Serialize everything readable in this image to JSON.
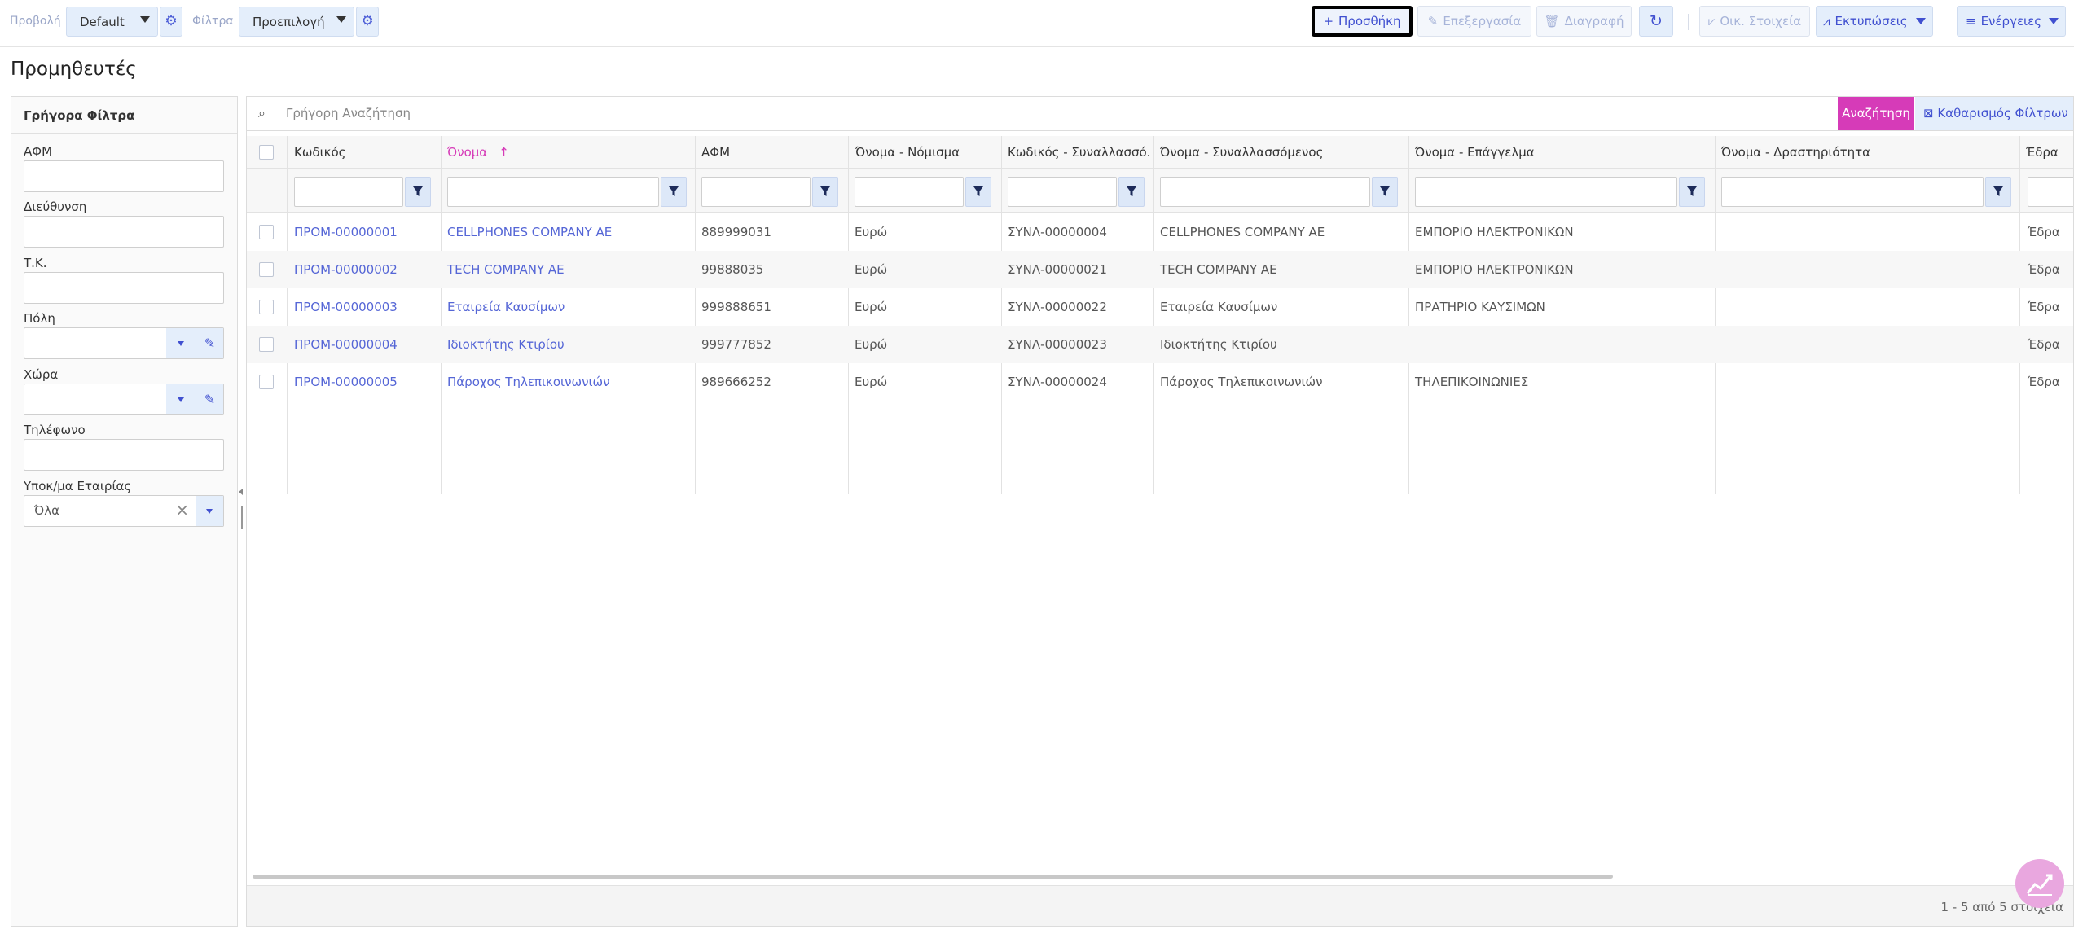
{
  "toolbar": {
    "view_label": "Προβολή",
    "view_value": "Default",
    "filters_label": "Φίλτρα",
    "filters_value": "Προεπιλογή",
    "add": "Προσθήκη",
    "edit": "Επεξεργασία",
    "delete": "Διαγραφή",
    "fin_data": "Οικ. Στοιχεία",
    "prints": "Εκτυπώσεις",
    "actions": "Ενέργειες"
  },
  "page": {
    "title": "Προμηθευτές"
  },
  "quick_filters": {
    "title": "Γρήγορα Φίλτρα",
    "fields": [
      "ΑΦΜ",
      "Διεύθυνση",
      "Τ.Κ.",
      "Πόλη",
      "Χώρα",
      "Τηλέφωνο",
      "Υποκ/μα Εταιρίας"
    ],
    "branch_value": "Όλα"
  },
  "search": {
    "placeholder": "Γρήγορη Αναζήτηση",
    "search_button": "Αναζήτηση",
    "clear_button": "Καθαρισμός Φίλτρων"
  },
  "grid": {
    "columns": [
      "Κωδικός",
      "Όνομα",
      "ΑΦΜ",
      "Όνομα - Νόμισμα",
      "Κωδικός - Συναλλασσό...",
      "Όνομα - Συναλλασσόμενος",
      "Όνομα - Επάγγελμα",
      "Όνομα - Δραστηριότητα",
      "Έδρα"
    ],
    "rows": [
      [
        "ΠΡΟΜ-00000001",
        "CELLPHONES COMPANY AE",
        "889999031",
        "Ευρώ",
        "ΣΥΝΛ-00000004",
        "CELLPHONES COMPANY AE",
        "ΕΜΠΟΡΙΟ ΗΛΕΚΤΡΟΝΙΚΩΝ",
        "",
        "Έδρα"
      ],
      [
        "ΠΡΟΜ-00000002",
        "TECH COMPANY AE",
        "99888035",
        "Ευρώ",
        "ΣΥΝΛ-00000021",
        "TECH COMPANY AE",
        "ΕΜΠΟΡΙΟ ΗΛΕΚΤΡΟΝΙΚΩΝ",
        "",
        "Έδρα"
      ],
      [
        "ΠΡΟΜ-00000003",
        "Εταιρεία Καυσίμων",
        "999888651",
        "Ευρώ",
        "ΣΥΝΛ-00000022",
        "Εταιρεία Καυσίμων",
        "ΠΡΑΤΗΡΙΟ ΚΑΥΣΙΜΩΝ",
        "",
        "Έδρα"
      ],
      [
        "ΠΡΟΜ-00000004",
        "Ιδιοκτήτης Κτιρίου",
        "999777852",
        "Ευρώ",
        "ΣΥΝΛ-00000023",
        "Ιδιοκτήτης Κτιρίου",
        "",
        "",
        "Έδρα"
      ],
      [
        "ΠΡΟΜ-00000005",
        "Πάροχος Τηλεπικοινωνιών",
        "989666252",
        "Ευρώ",
        "ΣΥΝΛ-00000024",
        "Πάροχος Τηλεπικοινωνιών",
        "ΤΗΛΕΠΙΚΟΙΝΩΝΙΕΣ",
        "",
        "Έδρα"
      ]
    ],
    "sorted_column": "Όνομα",
    "footer_info": "1 - 5 από 5 στοιχεία"
  },
  "colors": {
    "accent_pink": "#d63bb8",
    "accent_blue": "#4050d0",
    "link": "#5566d6"
  },
  "icons": {
    "view_settings": "gear-icon",
    "filters_settings": "gear-icon",
    "add": "plus-icon",
    "edit": "pencil-icon",
    "delete": "trash-icon",
    "refresh": "refresh-icon",
    "fin_data": "chart-icon",
    "prints": "chart-line-icon",
    "actions": "menu-icon",
    "search": "search-icon",
    "clear": "filter-clear-icon",
    "fab": "trend-chart-icon"
  }
}
